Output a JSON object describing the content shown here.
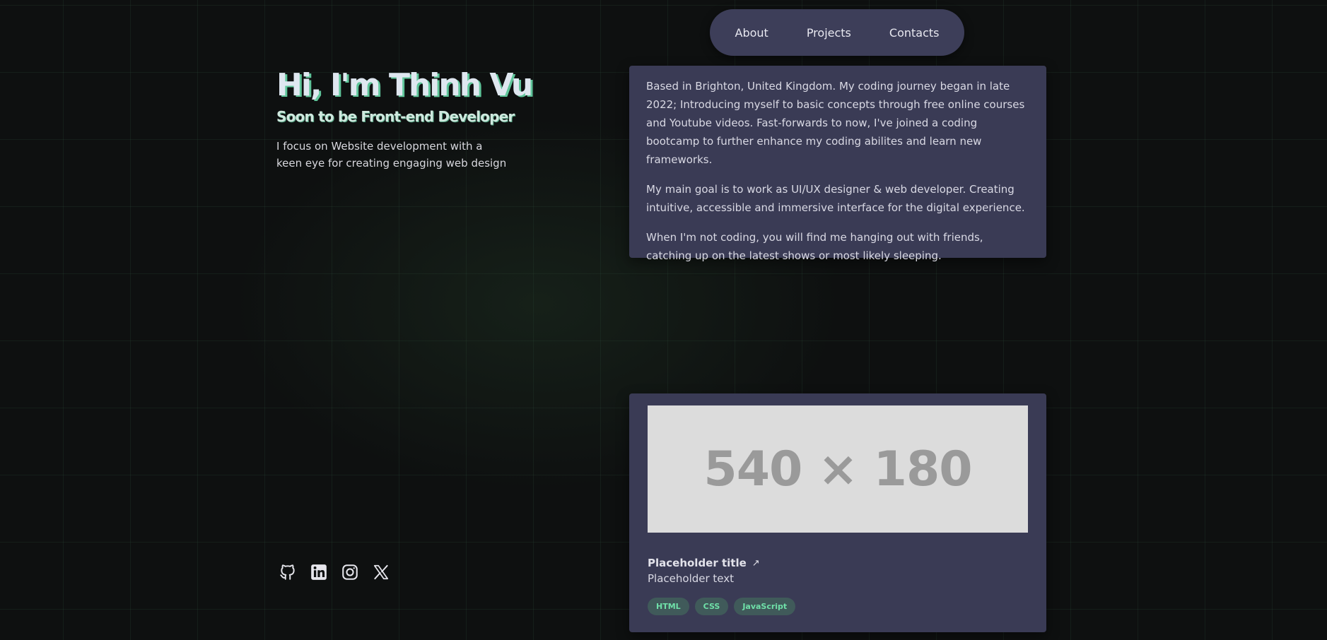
{
  "nav": {
    "about": "About",
    "projects": "Projects",
    "contacts": "Contacts"
  },
  "hero": {
    "title": "Hi, I'm Thinh Vu",
    "subtitle": "Soon to be Front-end Developer",
    "description": "I focus on Website development with a keen eye for creating engaging web design"
  },
  "about": {
    "paragraphs": [
      "Based in Brighton, United Kingdom. My coding journey began in late 2022; Introducing myself to basic concepts through free online courses and Youtube videos. Fast-forwards to now, I've joined a coding bootcamp to further enhance my coding abilites and learn new frameworks.",
      "My main goal is to work as UI/UX designer & web developer. Creating intuitive, accessible and immersive interface for the digital experience.",
      "When I'm not coding, you will find me hanging out with friends, catching up on the latest shows or most likely sleeping."
    ]
  },
  "project": {
    "thumbnail_text": "540 × 180",
    "title": "Placeholder title",
    "text": "Placeholder text",
    "tags": [
      "HTML",
      "CSS",
      "JavaScript"
    ]
  },
  "social": {
    "icons": [
      "github-icon",
      "linkedin-icon",
      "instagram-icon",
      "x-icon"
    ]
  },
  "colors": {
    "background": "#0e1010",
    "card": "#3a3b55",
    "nav": "#3d3e59",
    "accent": "#5fc59a",
    "tag_bg": "#405a5a",
    "tag_text": "#6fe0a8"
  }
}
